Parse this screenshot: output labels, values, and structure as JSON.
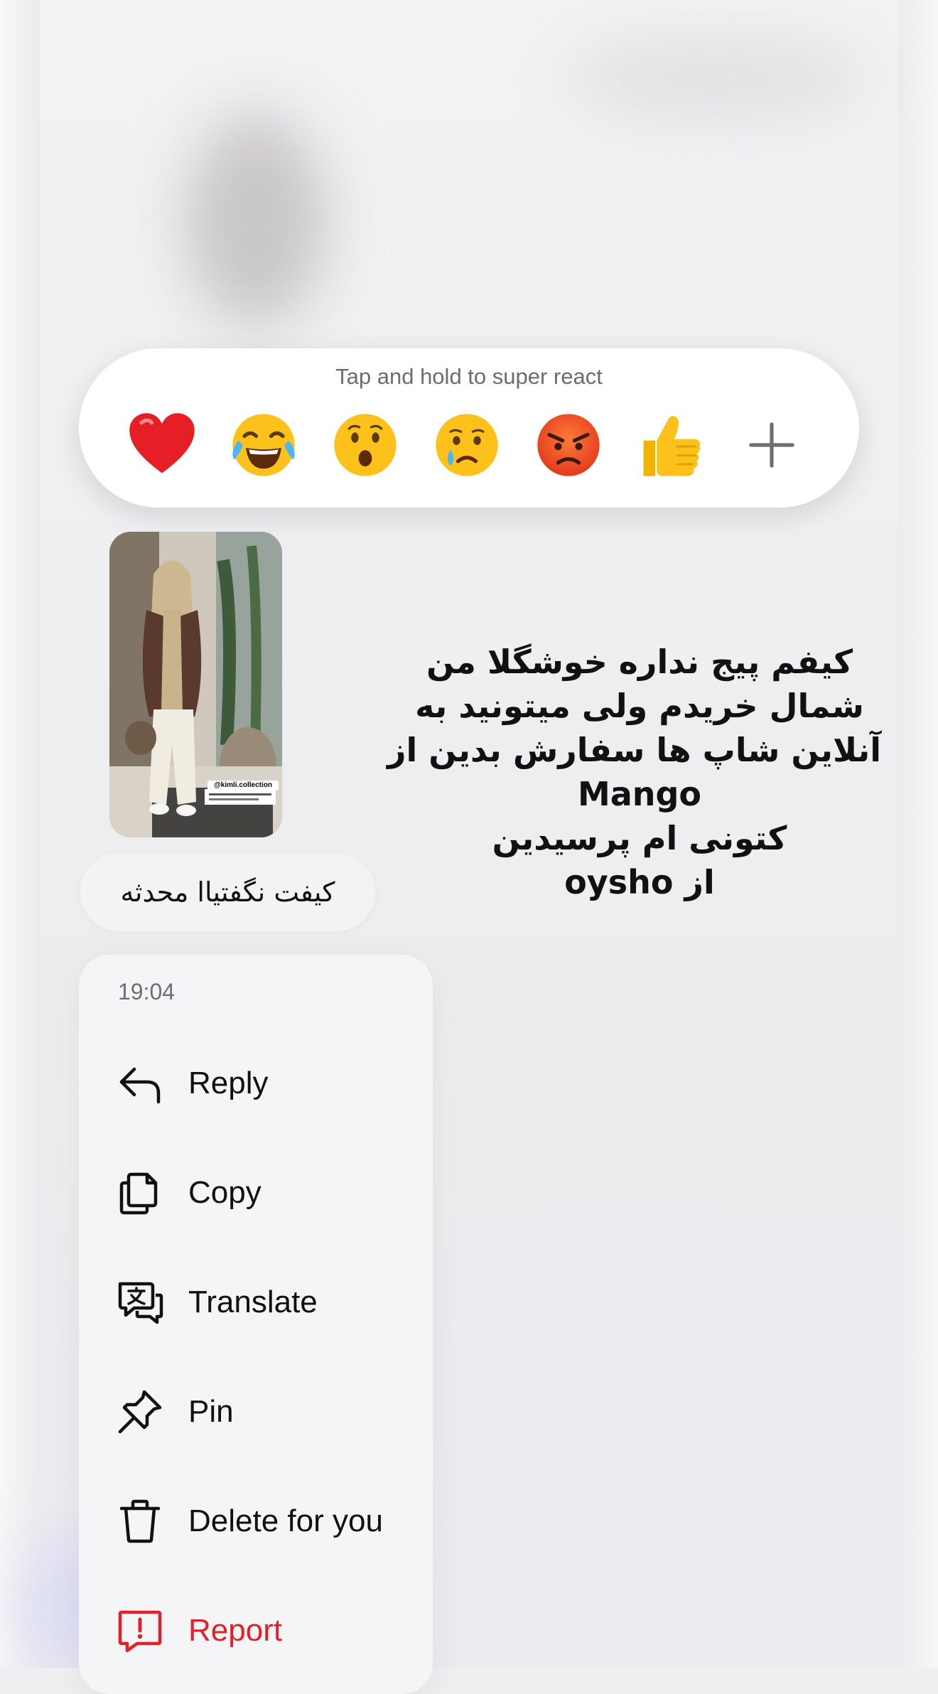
{
  "reactions": {
    "hint": "Tap and hold to super react",
    "items": [
      {
        "name": "red-heart",
        "icon": "red-heart-icon"
      },
      {
        "name": "tears-of-joy",
        "icon": "face-with-tears-of-joy-icon"
      },
      {
        "name": "surprised",
        "icon": "hushed-face-icon"
      },
      {
        "name": "crying",
        "icon": "crying-face-icon"
      },
      {
        "name": "angry",
        "icon": "angry-face-icon"
      },
      {
        "name": "thumbs-up",
        "icon": "thumbs-up-icon"
      },
      {
        "name": "more",
        "icon": "plus-icon"
      }
    ]
  },
  "shared_post": {
    "handle": "@kimli.collection"
  },
  "rtl_message": {
    "lines": [
      "کیفم پیج نداره خوشگلا من",
      "شمال خریدم ولی میتونید به",
      "آنلاین شاپ ها سفارش بدین از",
      "Mango",
      "کتونی ام پرسیدین",
      "از oysho"
    ]
  },
  "reply_bubble": {
    "text": "کیفت نگفتیاا محدثه"
  },
  "menu": {
    "timestamp": "19:04",
    "items": [
      {
        "label": "Reply",
        "icon": "reply-arrow-icon"
      },
      {
        "label": "Copy",
        "icon": "copy-icon"
      },
      {
        "label": "Translate",
        "icon": "translate-icon"
      },
      {
        "label": "Pin",
        "icon": "pin-icon"
      },
      {
        "label": "Delete for you",
        "icon": "trash-icon"
      },
      {
        "label": "Report",
        "icon": "report-icon"
      }
    ]
  },
  "colors": {
    "danger": "#e0212a",
    "menu_bg": "#f5f5f7",
    "reaction_bar_bg": "#ffffff"
  }
}
